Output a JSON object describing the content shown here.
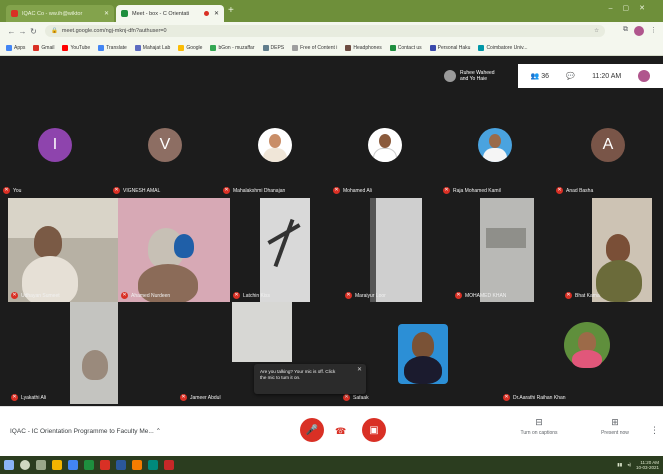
{
  "browser": {
    "tabs": [
      {
        "title": "IQAC Co - ww.ih@wiktor",
        "active": false
      },
      {
        "title": "Meet - box - C Orientati",
        "active": true
      }
    ],
    "url": "meet.google.com/ngj-mknj-dfn?authuser=0",
    "bookmarks": [
      "Apps",
      "Gmail",
      "YouTube",
      "Translate",
      "Mahajat Lab",
      "Google",
      "bGon - muzaffar",
      "DEPS",
      "Free of Content i",
      "Headphones",
      "Contact us",
      "Personal Haku",
      "Coimbatore Univ..."
    ]
  },
  "meet": {
    "presenter_label": "Ruhee Waheed and Yo Haie",
    "participant_count": "36",
    "time": "11:20 AM",
    "tiles": [
      {
        "name": "You",
        "initial": "I",
        "color": "#8e44ad"
      },
      {
        "name": "VIGNESH AMAL",
        "initial": "V",
        "color": "#8d6e63"
      },
      {
        "name": "Mahalakshmi Dhanajan",
        "initial": "",
        "color": ""
      },
      {
        "name": "Mohamed Ali",
        "initial": "",
        "color": ""
      },
      {
        "name": "Raja Mohamed Kamil",
        "initial": "",
        "color": ""
      },
      {
        "name": "Anad Basha",
        "initial": "A",
        "color": "#795548"
      },
      {
        "name": "Udhayan Sumeet",
        "initial": "",
        "color": ""
      },
      {
        "name": "Ahamed Nurdeen",
        "initial": "",
        "color": ""
      },
      {
        "name": "Latchin Kiss",
        "initial": "",
        "color": ""
      },
      {
        "name": "Maraiyur Loor",
        "initial": "",
        "color": ""
      },
      {
        "name": "MOHAMED KHAN",
        "initial": "",
        "color": ""
      },
      {
        "name": "Bhat Kama",
        "initial": "",
        "color": ""
      },
      {
        "name": "Lyakathi Ali",
        "initial": "",
        "color": ""
      },
      {
        "name": "Jameer Abdul",
        "initial": "",
        "color": ""
      },
      {
        "name": "Safaak",
        "initial": "",
        "color": ""
      },
      {
        "name": "Dr.Aarathi Raihan Khan",
        "initial": "",
        "color": ""
      }
    ],
    "toast": {
      "line1": "Are you talking? Your mic is off. Click",
      "line2": "the mic to turn it on."
    },
    "meeting_title": "IQAC - IC Orientation Programme to Faculty Me...",
    "caption_label": "Turn on captions",
    "present_label": "Present now",
    "accent": "#d93025"
  },
  "taskbar": {
    "time": "11:20 AM",
    "date": "10-03-2021"
  }
}
